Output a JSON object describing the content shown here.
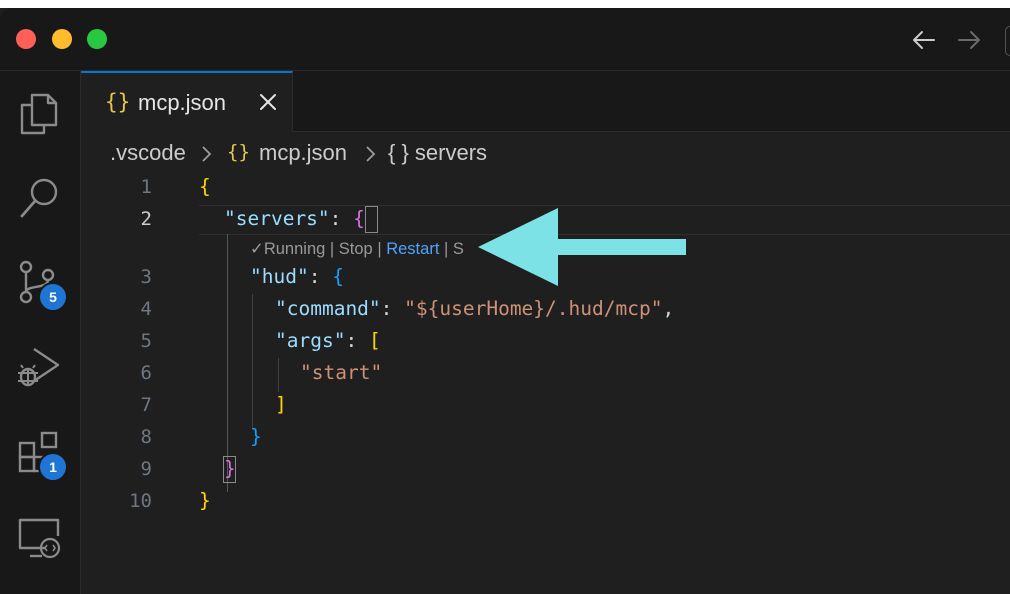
{
  "window": {
    "controls": [
      "close",
      "minimize",
      "maximize"
    ],
    "nav": [
      "arrow-left-icon",
      "arrow-right-icon"
    ]
  },
  "activity_bar": {
    "items": [
      {
        "icon": "explorer-icon"
      },
      {
        "icon": "search-icon"
      },
      {
        "icon": "source-control-icon",
        "badge": "5"
      },
      {
        "icon": "run-debug-icon"
      },
      {
        "icon": "extensions-icon",
        "badge": "1"
      },
      {
        "icon": "remote-explorer-icon"
      }
    ]
  },
  "tab": {
    "icon": "{}",
    "label": "mcp.json"
  },
  "breadcrumb": {
    "folder": ".vscode",
    "file_icon": "{}",
    "file": "mcp.json",
    "symbol": "{ } servers"
  },
  "codelens": {
    "status": "Running",
    "stop": "Stop",
    "restart": "Restart",
    "separator": "|",
    "trailing": "S"
  },
  "editor": {
    "line_numbers": [
      "1",
      "2",
      "3",
      "4",
      "5",
      "6",
      "7",
      "8",
      "9",
      "10"
    ],
    "active_line": "2",
    "lines": {
      "l1_brace": "{",
      "l2_key": "\"servers\"",
      "l2_colon": ": ",
      "l2_brace": "{",
      "l3_key": "\"hud\"",
      "l3_colon": ": ",
      "l3_brace": "{",
      "l4_key": "\"command\"",
      "l4_colon": ": ",
      "l4_value": "\"${userHome}/.hud/mcp\"",
      "l4_comma": ",",
      "l5_key": "\"args\"",
      "l5_colon": ": ",
      "l5_bracket": "[",
      "l6_value": "\"start\"",
      "l7_bracket": "]",
      "l8_brace": "}",
      "l9_brace": "}",
      "l10_brace": "}"
    }
  },
  "colors": {
    "background": "#1f1f1f",
    "json_key": "#9cdcfe",
    "json_string": "#ce9178",
    "bracket_level1": "#ffd700",
    "bracket_level2": "#da70d6",
    "bracket_level3": "#179fff",
    "badge": "#1e75d3",
    "annotation_arrow": "#7de2e6",
    "tab_accent": "#0078d4"
  },
  "annotation": {
    "icon": "annotation-arrow-icon"
  }
}
